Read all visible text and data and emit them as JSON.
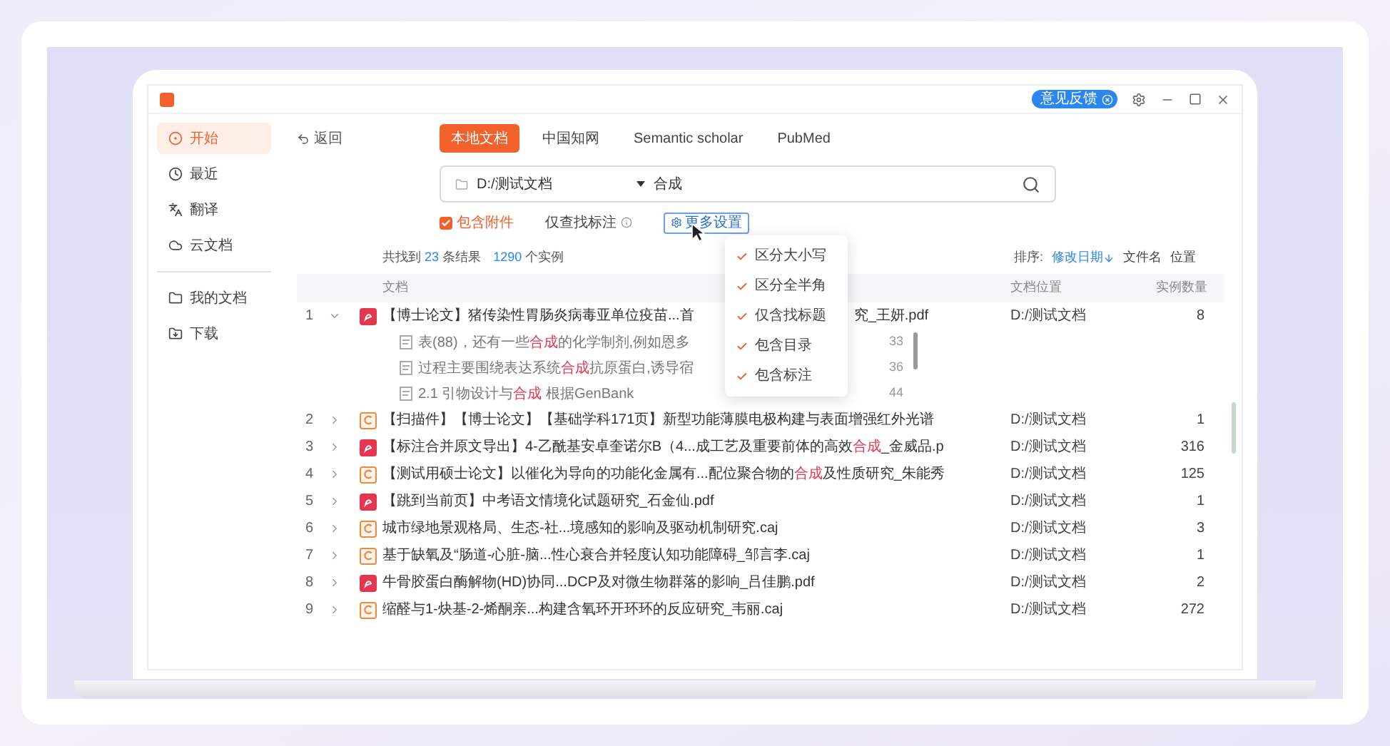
{
  "window": {
    "feedback_button": "意见反馈"
  },
  "sidebar": {
    "items": [
      {
        "label": "开始",
        "selected": true
      },
      {
        "label": "最近",
        "selected": false
      },
      {
        "label": "翻译",
        "selected": false
      },
      {
        "label": "云文档",
        "selected": false
      }
    ],
    "lower_items": [
      {
        "label": "我的文档",
        "selected": false
      },
      {
        "label": "下载",
        "selected": false
      }
    ]
  },
  "back": "返回",
  "tabs": [
    {
      "label": "本地文档",
      "selected": true
    },
    {
      "label": "中国知网",
      "selected": false
    },
    {
      "label": "Semantic scholar",
      "selected": false
    },
    {
      "label": "PubMed",
      "selected": false
    }
  ],
  "search": {
    "folder": "D:/测试文档",
    "query": "合成"
  },
  "options": [
    {
      "kind": "checkbox",
      "label": "包含附件",
      "checked": true
    },
    {
      "kind": "info",
      "label": "仅查找标注"
    },
    {
      "kind": "button",
      "label": "更多设置"
    }
  ],
  "more_settings_menu": [
    {
      "label": "区分大小写",
      "checked": true
    },
    {
      "label": "区分全半角",
      "checked": true
    },
    {
      "label": "仅含找标题",
      "checked": true
    },
    {
      "label": "包含目录",
      "checked": true
    },
    {
      "label": "包含标注",
      "checked": true
    }
  ],
  "summary": {
    "prefix": "共找到",
    "results": "23",
    "results_suffix": "条结果",
    "instances": "1290",
    "instances_suffix": "个实例"
  },
  "sort": {
    "label": "排序:",
    "options": [
      {
        "label": "修改日期",
        "selected": true
      },
      {
        "label": "文件名",
        "selected": false
      },
      {
        "label": "位置",
        "selected": false
      }
    ]
  },
  "columns": [
    "文档",
    "文档位置",
    "实例数量"
  ],
  "rows": [
    {
      "index": "1",
      "expanded": true,
      "kind": "pdf",
      "title": [
        {
          "text": "【博士论文】猪传染性胃肠炎病毒亚单位疫苗...首",
          "highlighted": false
        }
      ],
      "title_end": [
        {
          "text": "究_王妍.pdf",
          "highlighted": false
        }
      ],
      "location": "D:/测试文档",
      "count": "8",
      "matches": [
        {
          "text": [
            {
              "text": "表(88)，还有一些",
              "highlighted": false
            },
            {
              "text": "合成",
              "highlighted": true
            },
            {
              "text": "的化学制剂,例如恩多",
              "highlighted": false
            }
          ],
          "page": "33"
        },
        {
          "text": [
            {
              "text": "过程主要围绕表达系统",
              "highlighted": false
            },
            {
              "text": "合成",
              "highlighted": true
            },
            {
              "text": "抗原蛋白,诱导宿",
              "highlighted": false
            }
          ],
          "page": "36"
        },
        {
          "text": [
            {
              "text": "2.1 引物设计与",
              "highlighted": false
            },
            {
              "text": "合成",
              "highlighted": true
            },
            {
              "text": " 根据GenBank",
              "highlighted": false
            }
          ],
          "page": "44"
        }
      ]
    },
    {
      "index": "2",
      "expanded": false,
      "kind": "caj",
      "title": [
        {
          "text": "【扫描件】【博士论文】【基础学科171页】新型功能薄膜电极构建与表面增强红外光谱",
          "highlighted": false
        }
      ],
      "location": "D:/测试文档",
      "count": "1"
    },
    {
      "index": "3",
      "expanded": false,
      "kind": "pdf",
      "title": [
        {
          "text": "【标注合并原文导出】4-乙酰基安卓奎诺尔B（4...成工艺及重要前体的高效",
          "highlighted": false
        },
        {
          "text": "合成",
          "highlighted": true
        },
        {
          "text": "_金威品.p",
          "highlighted": false
        }
      ],
      "location": "D:/测试文档",
      "count": "316"
    },
    {
      "index": "4",
      "expanded": false,
      "kind": "caj",
      "title": [
        {
          "text": "【测试用硕士论文】以催化为导向的功能化金属有...配位聚合物的",
          "highlighted": false
        },
        {
          "text": "合成",
          "highlighted": true
        },
        {
          "text": "及性质研究_朱能秀",
          "highlighted": false
        }
      ],
      "location": "D:/测试文档",
      "count": "125"
    },
    {
      "index": "5",
      "expanded": false,
      "kind": "pdf",
      "title": [
        {
          "text": "【跳到当前页】中考语文情境化试题研究_石金仙.pdf",
          "highlighted": false
        }
      ],
      "location": "D:/测试文档",
      "count": "1"
    },
    {
      "index": "6",
      "expanded": false,
      "kind": "caj",
      "title": [
        {
          "text": "城市绿地景观格局、生态-社...境感知的影响及驱动机制研究.caj",
          "highlighted": false
        }
      ],
      "location": "D:/测试文档",
      "count": "3"
    },
    {
      "index": "7",
      "expanded": false,
      "kind": "caj",
      "title": [
        {
          "text": "基于缺氧及“肠道-心脏-脑...性心衰合并轻度认知功能障碍_邹言李.caj",
          "highlighted": false
        }
      ],
      "location": "D:/测试文档",
      "count": "1"
    },
    {
      "index": "8",
      "expanded": false,
      "kind": "pdf",
      "title": [
        {
          "text": "牛骨胶蛋白酶解物(HD)协同...DCP及对微生物群落的影响_吕佳鹏.pdf",
          "highlighted": false
        }
      ],
      "location": "D:/测试文档",
      "count": "2"
    },
    {
      "index": "9",
      "expanded": false,
      "kind": "caj",
      "title": [
        {
          "text": "缩醛与1-炔基-2-烯酮亲...构建含氧环开环环的反应研究_韦丽.caj",
          "highlighted": false
        }
      ],
      "location": "D:/测试文档",
      "count": "272"
    }
  ]
}
